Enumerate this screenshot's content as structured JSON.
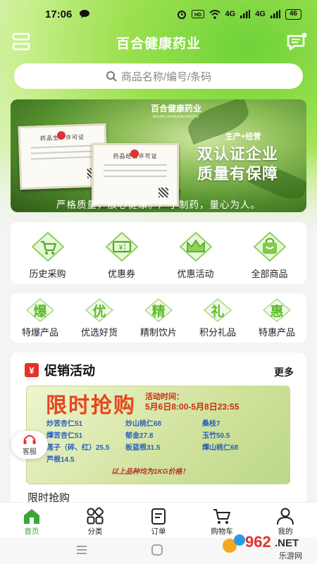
{
  "status_bar": {
    "time": "17:06",
    "network": "4G",
    "signal": "4G",
    "battery": "46"
  },
  "header": {
    "title": "百合健康药业"
  },
  "search": {
    "placeholder": "商品名称/编号/条码"
  },
  "banner": {
    "brand": "百合健康药业",
    "brand_sub": "BAIHEJIANKANGYAOYE",
    "cert1": "药品生产许可证",
    "cert2": "药品经营许可证",
    "tag": "生产+经营",
    "headline1": "双认证企业",
    "headline2": "质量有保障",
    "slogan": "严格质量，放心健康。严于制药，量心为人。"
  },
  "quick_menu": [
    {
      "label": "历史采购",
      "icon": "cart-icon"
    },
    {
      "label": "优惠券",
      "icon": "coupon-icon"
    },
    {
      "label": "优惠活动",
      "icon": "crown-icon"
    },
    {
      "label": "全部商品",
      "icon": "bag-icon"
    }
  ],
  "categories": [
    {
      "char": "爆",
      "label": "特爆产品"
    },
    {
      "char": "优",
      "label": "优选好货"
    },
    {
      "char": "精",
      "label": "精制饮片"
    },
    {
      "char": "礼",
      "label": "积分礼品"
    },
    {
      "char": "惠",
      "label": "特惠产品"
    }
  ],
  "promo": {
    "yen": "¥",
    "title": "促销活动",
    "more": "更多",
    "flash": {
      "big": "限时抢购",
      "time_label": "活动时间：",
      "time_value": "5月6日8:00-5月8日23:55",
      "items": [
        "炒苦杏仁51",
        "炒山桃仁68",
        "桑枝7",
        "燀苦杏仁51",
        "郁金27.8",
        "玉竹50.5",
        "莲子（碎、红）25.5",
        "板蓝根31.5",
        "燀山桃仁68",
        "芦根14.5"
      ],
      "footnote": "以上品种均为1KG价格！"
    },
    "flash_name": "限时抢购"
  },
  "service": {
    "label": "客服"
  },
  "tabbar": [
    {
      "label": "首页",
      "icon": "home-icon",
      "active": true
    },
    {
      "label": "分类",
      "icon": "category-icon",
      "active": false
    },
    {
      "label": "订单",
      "icon": "order-icon",
      "active": false
    },
    {
      "label": "购物车",
      "icon": "cart-icon",
      "active": false
    },
    {
      "label": "我的",
      "icon": "user-icon",
      "active": false
    }
  ],
  "watermark": {
    "text1": "962",
    "text2": ".NET",
    "text3": "乐游网"
  },
  "colors": {
    "accent": "#5dbb2a",
    "promo_red": "#e7461e",
    "tab_active": "#3aa53a"
  }
}
